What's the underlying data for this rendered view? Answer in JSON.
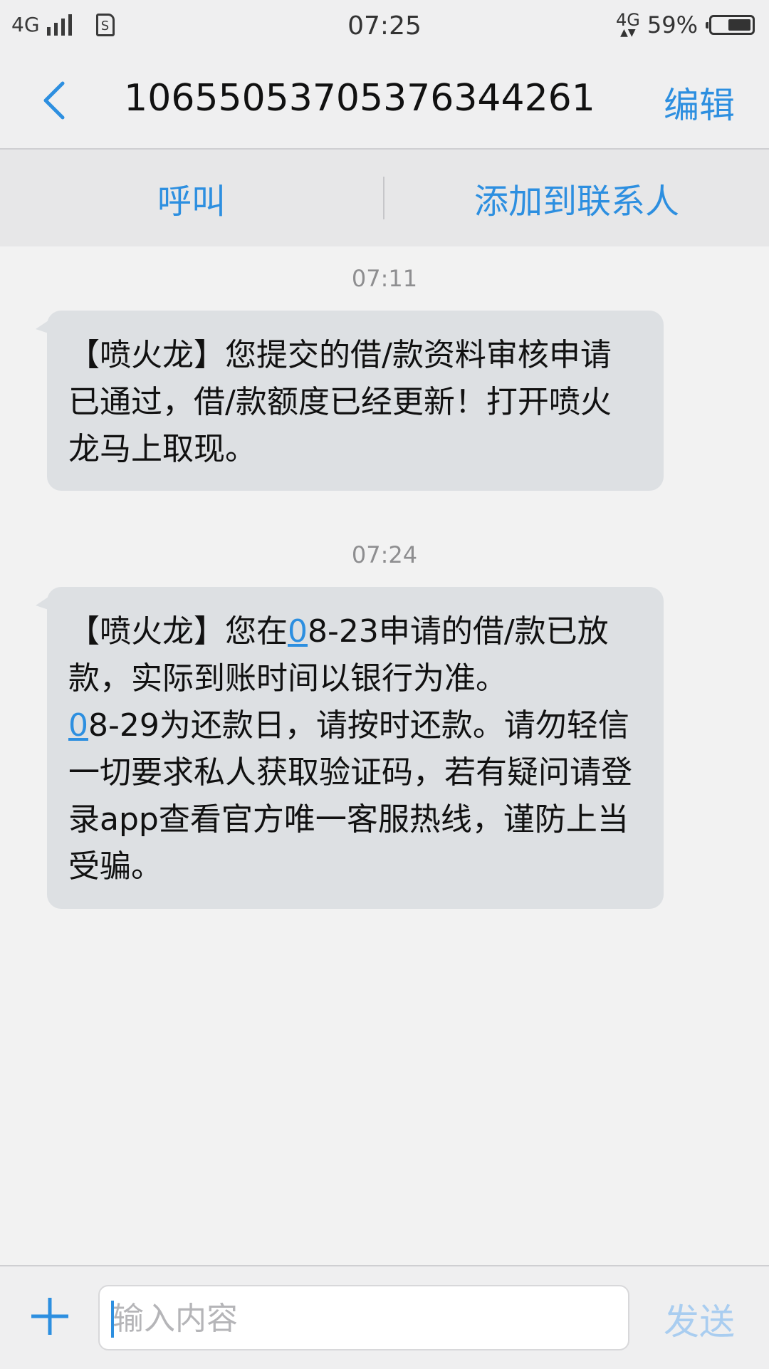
{
  "status_bar": {
    "network_left": "4G",
    "time": "07:25",
    "network_right": "4G",
    "battery_percent": "59%",
    "battery_level": 0.59
  },
  "header": {
    "title": "10655053705376344261",
    "edit_label": "编辑",
    "back_icon": "chevron-left-icon"
  },
  "actions": {
    "call_label": "呼叫",
    "add_contact_label": "添加到联系人"
  },
  "messages": [
    {
      "time": "07:11",
      "text": "【喷火龙】您提交的借/款资料审核申请已通过，借/款额度已经更新！打开喷火龙马上取现。"
    },
    {
      "time": "07:24",
      "text_before_link1": "【喷火龙】您在",
      "link1": "0",
      "text_after_link1": "8-23申请的借/款已放款，实际到账时间以银行为准。",
      "link2": "0",
      "text_after_link2": "8-29为还款日，请按时还款。请勿轻信一切要求私人获取验证码，若有疑问请登录app查看官方唯一客服热线，谨防上当受骗。"
    }
  ],
  "composer": {
    "placeholder": "输入内容",
    "send_label": "发送",
    "plus_icon": "plus-icon"
  },
  "colors": {
    "accent": "#2d8fe0",
    "send_disabled": "#a9cdf0",
    "bubble": "#dde0e3",
    "background": "#f2f2f2"
  }
}
